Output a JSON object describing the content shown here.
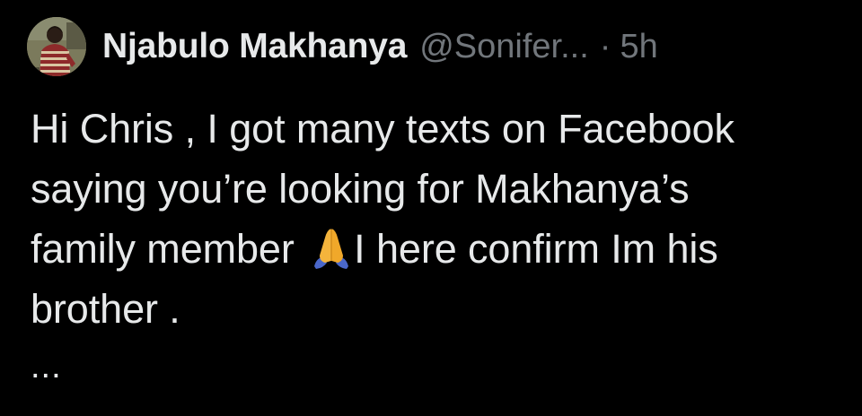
{
  "tweet": {
    "author": {
      "display_name": "Njabulo Makhanya",
      "handle": "@Sonifer...",
      "avatar_icon": "profile-photo-avatar"
    },
    "separator": "·",
    "timestamp": "5h",
    "text_lines": [
      "Hi Chris , I got many texts on Facebook",
      "saying you’re looking for Makhanya’s",
      "family member ",
      "I here confirm Im his",
      "brother ."
    ],
    "emoji_icon": "folded-hands-emoji",
    "truncation": "..."
  },
  "colors": {
    "background": "#000000",
    "primary_text": "#e7e9ea",
    "secondary_text": "#71767b",
    "emoji_skin": "#f4b43c",
    "emoji_sleeve": "#4a67c9"
  }
}
